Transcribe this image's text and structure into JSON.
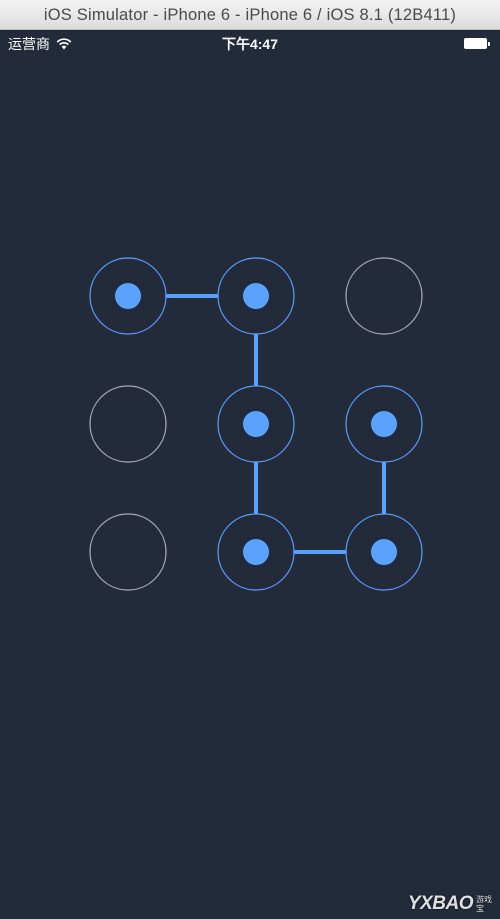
{
  "window": {
    "title": "iOS Simulator - iPhone 6 - iPhone 6 / iOS 8.1 (12B411)"
  },
  "status_bar": {
    "carrier": "运营商",
    "time": "下午4:47",
    "wifi_icon": "wifi-icon",
    "battery_icon": "battery-icon"
  },
  "pattern_lock": {
    "colors": {
      "background": "#232b3b",
      "active": "#5aa2ff",
      "inactive": "#a9adb7"
    },
    "nodes": [
      {
        "id": 1,
        "selected": true
      },
      {
        "id": 2,
        "selected": true
      },
      {
        "id": 3,
        "selected": false
      },
      {
        "id": 4,
        "selected": false
      },
      {
        "id": 5,
        "selected": true
      },
      {
        "id": 6,
        "selected": true
      },
      {
        "id": 7,
        "selected": false
      },
      {
        "id": 8,
        "selected": true
      },
      {
        "id": 9,
        "selected": true
      }
    ],
    "path": [
      1,
      2,
      5,
      8,
      9,
      6
    ]
  },
  "watermark": {
    "text": "YXBAO",
    "sub": "游戏宝"
  }
}
